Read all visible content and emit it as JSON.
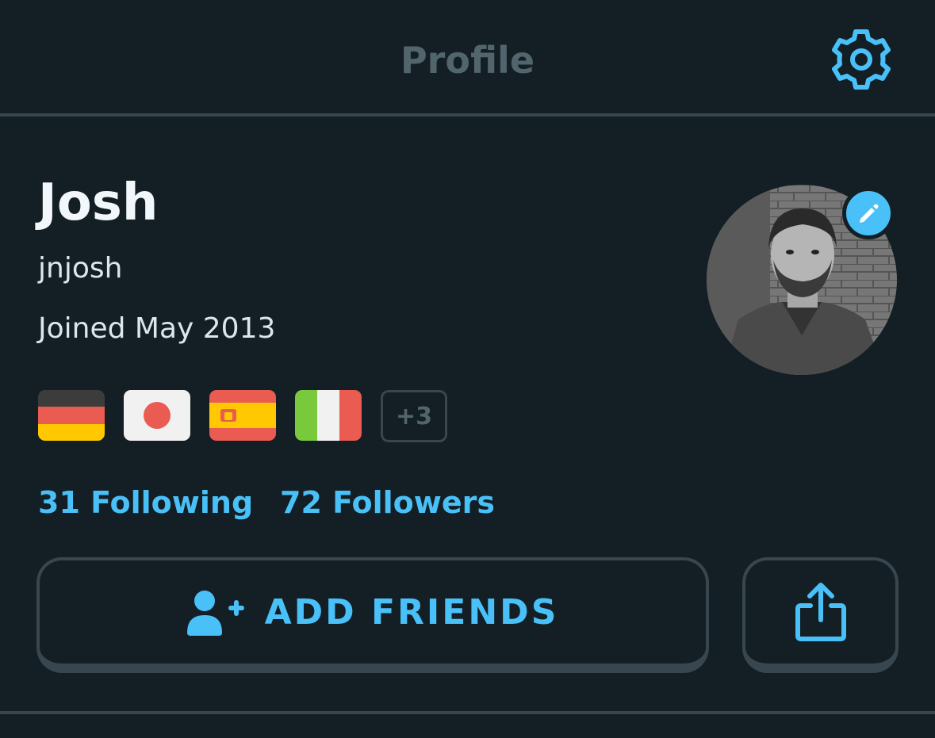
{
  "header": {
    "title": "Profile",
    "settings_icon": "gear-icon"
  },
  "profile": {
    "name": "Josh",
    "username": "jnjosh",
    "joined": "Joined May 2013",
    "avatar": "profile-photo",
    "edit_icon": "pencil-icon"
  },
  "languages": {
    "flags": [
      "germany-flag",
      "japan-flag",
      "spain-flag",
      "italy-flag"
    ],
    "more_label": "+3"
  },
  "stats": {
    "following_label": "31 Following",
    "followers_label": "72 Followers"
  },
  "actions": {
    "add_friends_label": "ADD FRIENDS",
    "add_friends_icon": "add-user-icon",
    "share_icon": "share-icon"
  },
  "colors": {
    "background": "#131f24",
    "divider": "#37464f",
    "accent": "#49c0f8",
    "title_gray": "#52656d",
    "text_primary": "#f1f7fb"
  }
}
